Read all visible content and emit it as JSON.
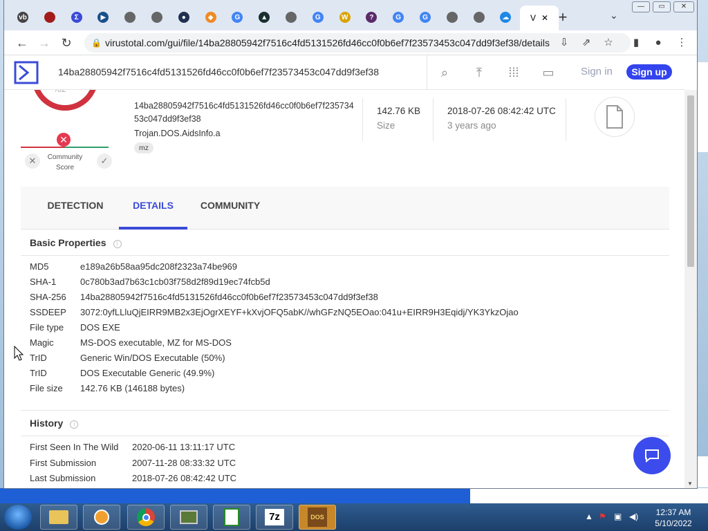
{
  "browser": {
    "tabs": [
      {
        "icon": "vb-icon",
        "letter": "vb",
        "color": "#444444"
      },
      {
        "icon": "red-square-icon",
        "letter": "",
        "color": "#a21c1c"
      },
      {
        "icon": "virustotal-icon",
        "letter": "Σ",
        "color": "#3b4bd6"
      },
      {
        "icon": "box-icon",
        "letter": "▶",
        "color": "#1a4f8c"
      },
      {
        "icon": "globe-icon",
        "letter": "",
        "color": "#666666"
      },
      {
        "icon": "globe-icon",
        "letter": "",
        "color": "#666666"
      },
      {
        "icon": "earth-icon",
        "letter": "●",
        "color": "#203050"
      },
      {
        "icon": "diamond-icon",
        "letter": "◆",
        "color": "#f08a24"
      },
      {
        "icon": "google-icon",
        "letter": "G",
        "color": "#4285f4"
      },
      {
        "icon": "triangle-icon",
        "letter": "▲",
        "color": "#1a3030"
      },
      {
        "icon": "globe-icon",
        "letter": "",
        "color": "#666666"
      },
      {
        "icon": "google-icon",
        "letter": "G",
        "color": "#4285f4"
      },
      {
        "icon": "wbo-icon",
        "letter": "W",
        "color": "#d9a400"
      },
      {
        "icon": "question-icon",
        "letter": "?",
        "color": "#5a2a6a"
      },
      {
        "icon": "google-icon",
        "letter": "G",
        "color": "#4285f4"
      },
      {
        "icon": "google-icon",
        "letter": "G",
        "color": "#4285f4"
      },
      {
        "icon": "globe-icon",
        "letter": "",
        "color": "#666666"
      },
      {
        "icon": "globe-icon",
        "letter": "",
        "color": "#666666"
      },
      {
        "icon": "cloud-icon",
        "letter": "☁",
        "color": "#1e88e5"
      }
    ],
    "active_tab_label": "V",
    "new_tab": "+",
    "url": "virustotal.com/gui/file/14ba28805942f7516c4fd5131526fd46cc0f0b6ef7f23573453c047dd9f3ef38/details"
  },
  "vt": {
    "search_value": "14ba28805942f7516c4fd5131526fd46cc0f0b6ef7f23573453c047dd9f3ef38",
    "sign_in": "Sign in",
    "sign_up": "Sign up",
    "ring_text": "/62",
    "community_label": "Community Score",
    "file_hash_display": "14ba28805942f7516c4fd5131526fd46cc0f0b6ef7f23573453c047dd9f3ef38",
    "detection_name": "Trojan.DOS.AidsInfo.a",
    "tag": "mz",
    "size_value": "142.76 KB",
    "size_label": "Size",
    "date_value": "2018-07-26 08:42:42 UTC",
    "date_label": "3 years ago",
    "tabs": [
      "DETECTION",
      "DETAILS",
      "COMMUNITY"
    ],
    "basic_title": "Basic Properties",
    "basic_properties": [
      {
        "key": "MD5",
        "value": "e189a26b58aa95dc208f2323a74be969"
      },
      {
        "key": "SHA-1",
        "value": "0c780b3ad7b63c1cb03f758d2f89d19ec74fcb5d"
      },
      {
        "key": "SHA-256",
        "value": "14ba28805942f7516c4fd5131526fd46cc0f0b6ef7f23573453c047dd9f3ef38"
      },
      {
        "key": "SSDEEP",
        "value": "3072:0yfLLluQjEIRR9MB2x3EjOgrXEYF+kXvjOFQ5abK//whGFzNQ5EOao:041u+EIRR9H3Eqidj/YK3YkzOjao"
      },
      {
        "key": "File type",
        "value": "DOS EXE"
      },
      {
        "key": "Magic",
        "value": "MS-DOS executable, MZ for MS-DOS"
      },
      {
        "key": "TrID",
        "value": "Generic Win/DOS Executable (50%)"
      },
      {
        "key": "TrID",
        "value": "DOS Executable Generic (49.9%)"
      },
      {
        "key": "File size",
        "value": "142.76 KB (146188 bytes)"
      }
    ],
    "history_title": "History",
    "history": [
      {
        "key": "First Seen In The Wild",
        "value": "2020-06-11 13:11:17 UTC"
      },
      {
        "key": "First Submission",
        "value": "2007-11-28 08:33:32 UTC"
      },
      {
        "key": "Last Submission",
        "value": "2018-07-26 08:42:42 UTC"
      }
    ]
  },
  "taskbar": {
    "apps": [
      "explorer-icon",
      "media-player-icon",
      "chrome-icon",
      "network-icon",
      "notepad-icon",
      "7zip-icon",
      "dosbox-icon"
    ],
    "sevenzip_label": "7z",
    "dos_label": "DOS",
    "time": "12:37 AM",
    "date": "5/10/2022"
  },
  "colors": {
    "accent": "#3b4bd6",
    "danger": "#d0323f",
    "signup": "#3344ee"
  }
}
